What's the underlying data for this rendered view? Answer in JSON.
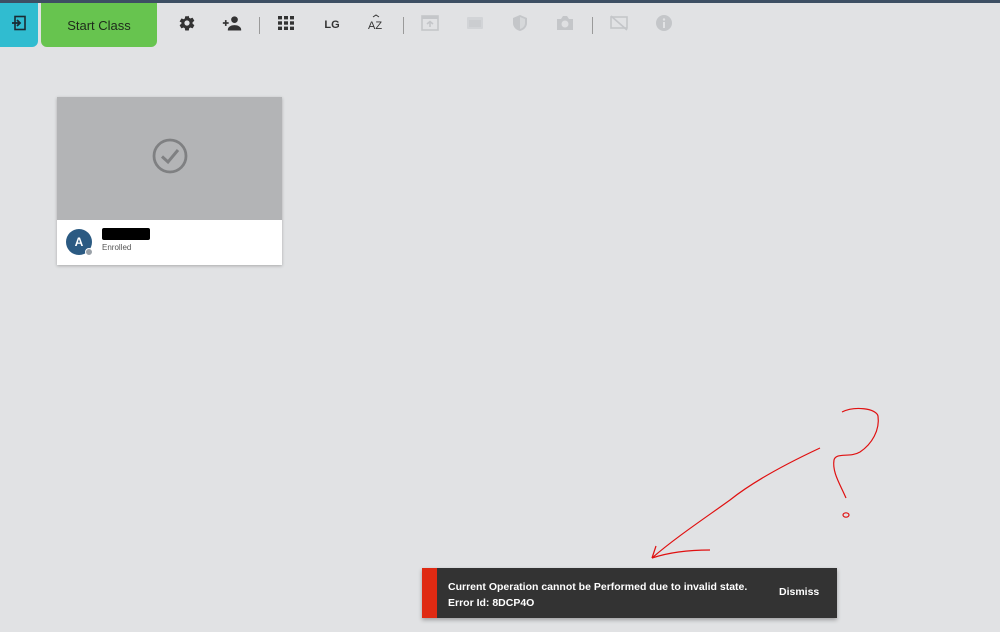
{
  "toolbar": {
    "start_class_label": "Start Class",
    "size_label": "LG",
    "sort_label": "AZ",
    "icons": [
      "exit-icon",
      "gear-icon",
      "add-person-icon",
      "grid-icon",
      "size-toggle-icon",
      "sort-az-icon",
      "window-icon",
      "browser-lock-icon",
      "shield-icon",
      "camera-icon",
      "screen-off-icon",
      "info-icon"
    ]
  },
  "student_card": {
    "avatar_initial": "A",
    "name": "",
    "status": "Enrolled",
    "media_icon": "check-circle-icon"
  },
  "toast": {
    "line1": "Current Operation cannot be Performed due to invalid state.",
    "line2": "Error Id: 8DCP4O",
    "dismiss_label": "Dismiss"
  },
  "colors": {
    "top_line": "#3d4f63",
    "exit_button": "#30bcd0",
    "start_class_button": "#67c44f",
    "background": "#e1e2e4",
    "toast_background": "#333333",
    "toast_accent": "#df2a13",
    "avatar": "#2b5a82",
    "annotation": "#e01010"
  }
}
